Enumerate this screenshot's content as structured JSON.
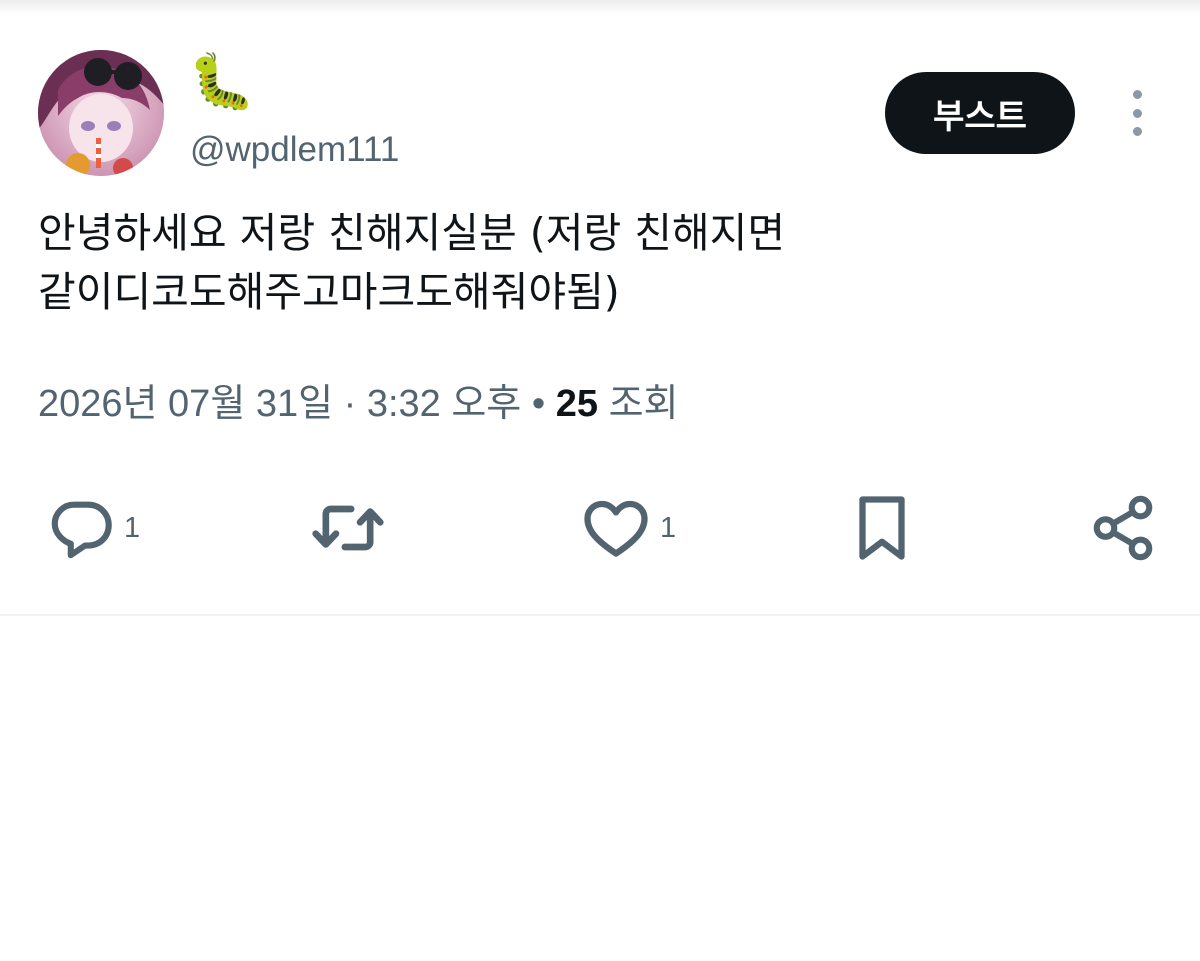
{
  "tweet": {
    "display_name": "🐛",
    "handle": "@wpdlem111",
    "text_lines": [
      "안녕하세요 저랑 친해지실분 (저랑 친해지면",
      "같이디코도해주고마크도해줘야됨)"
    ],
    "timestamp": "2026년 07월 31일 · 3:32 오후",
    "separator": "•",
    "views_count": "25",
    "views_label": "조회"
  },
  "header": {
    "boost_label": "부스트"
  },
  "actions": {
    "reply_count": "1",
    "like_count": "1"
  },
  "icons": {
    "reply": "reply-icon",
    "retweet": "retweet-icon",
    "like": "heart-icon",
    "bookmark": "bookmark-icon",
    "share": "share-icon",
    "more": "more-vertical-icon"
  },
  "colors": {
    "text": "#0f1419",
    "secondary": "#536471",
    "icon": "#536471",
    "button_bg": "#0f1419",
    "button_text": "#ffffff",
    "divider": "#eff3f4"
  }
}
